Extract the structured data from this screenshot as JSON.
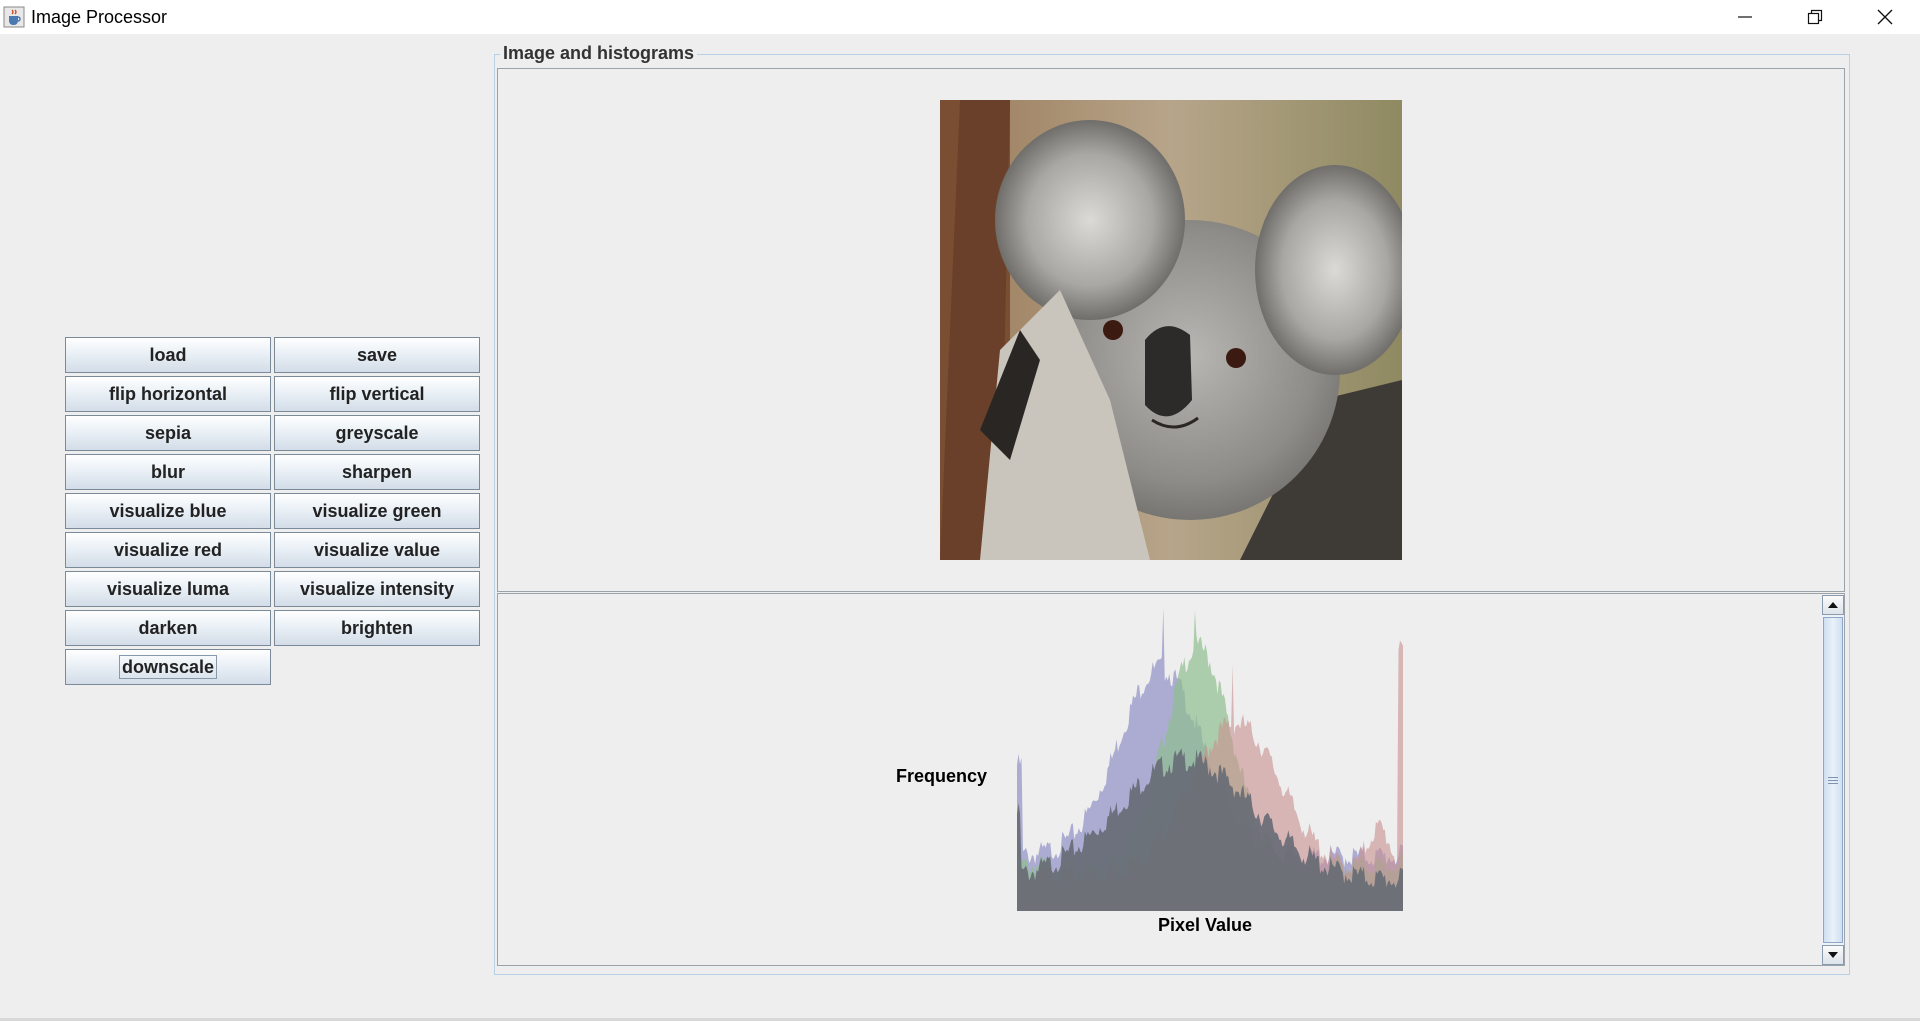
{
  "window": {
    "title": "Image Processor",
    "app_icon": "java-cup-icon",
    "controls": [
      "minimize-icon",
      "restore-icon",
      "close-icon"
    ]
  },
  "buttons": {
    "load": "load",
    "save": "save",
    "flip_horizontal": "flip horizontal",
    "flip_vertical": "flip vertical",
    "sepia": "sepia",
    "greyscale": "greyscale",
    "blur": "blur",
    "sharpen": "sharpen",
    "visualize_blue": "visualize blue",
    "visualize_green": "visualize green",
    "visualize_red": "visualize red",
    "visualize_value": "visualize value",
    "visualize_luma": "visualize luma",
    "visualize_intensity": "visualize intensity",
    "darken": "darken",
    "brighten": "brighten",
    "downscale": "downscale"
  },
  "panel": {
    "title": "Image and histograms",
    "image": "koala photo"
  },
  "histogram": {
    "ylabel": "Frequency",
    "xlabel": "Pixel Value",
    "colors": {
      "red": "#c98f8f",
      "green": "#8fbf8f",
      "blue": "#9595c8",
      "intensity": "#666a74"
    }
  }
}
